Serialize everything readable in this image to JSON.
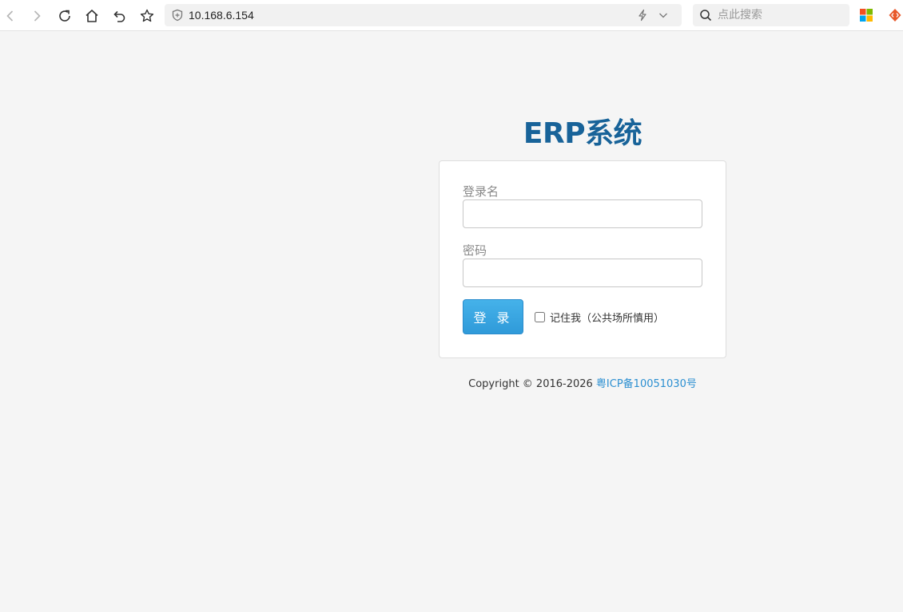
{
  "browser": {
    "url": "10.168.6.154",
    "search_placeholder": "点此搜索",
    "icons": {
      "back": "back-arrow-icon",
      "forward": "forward-arrow-icon",
      "reload": "reload-icon",
      "home": "home-icon",
      "undo": "undo-icon",
      "bookmark": "star-icon",
      "security": "shield-icon",
      "speed": "lightning-icon",
      "dropdown": "chevron-down-icon",
      "search": "search-icon",
      "apps": "apps-grid-icon",
      "extension": "extension-icon"
    }
  },
  "login": {
    "title": "ERP系统",
    "username_label": "登录名",
    "username_value": "",
    "password_label": "密码",
    "password_value": "",
    "submit_label": "登 录",
    "remember_label": "记住我（公共场所慎用）",
    "remember_checked": false
  },
  "footer": {
    "copyright": "Copyright © 2016-2026 ",
    "icp_link": "粤ICP备10051030号"
  },
  "colors": {
    "title": "#186399",
    "button": "#35a3e0",
    "link": "#2b8fd1",
    "background": "#f5f5f5"
  }
}
